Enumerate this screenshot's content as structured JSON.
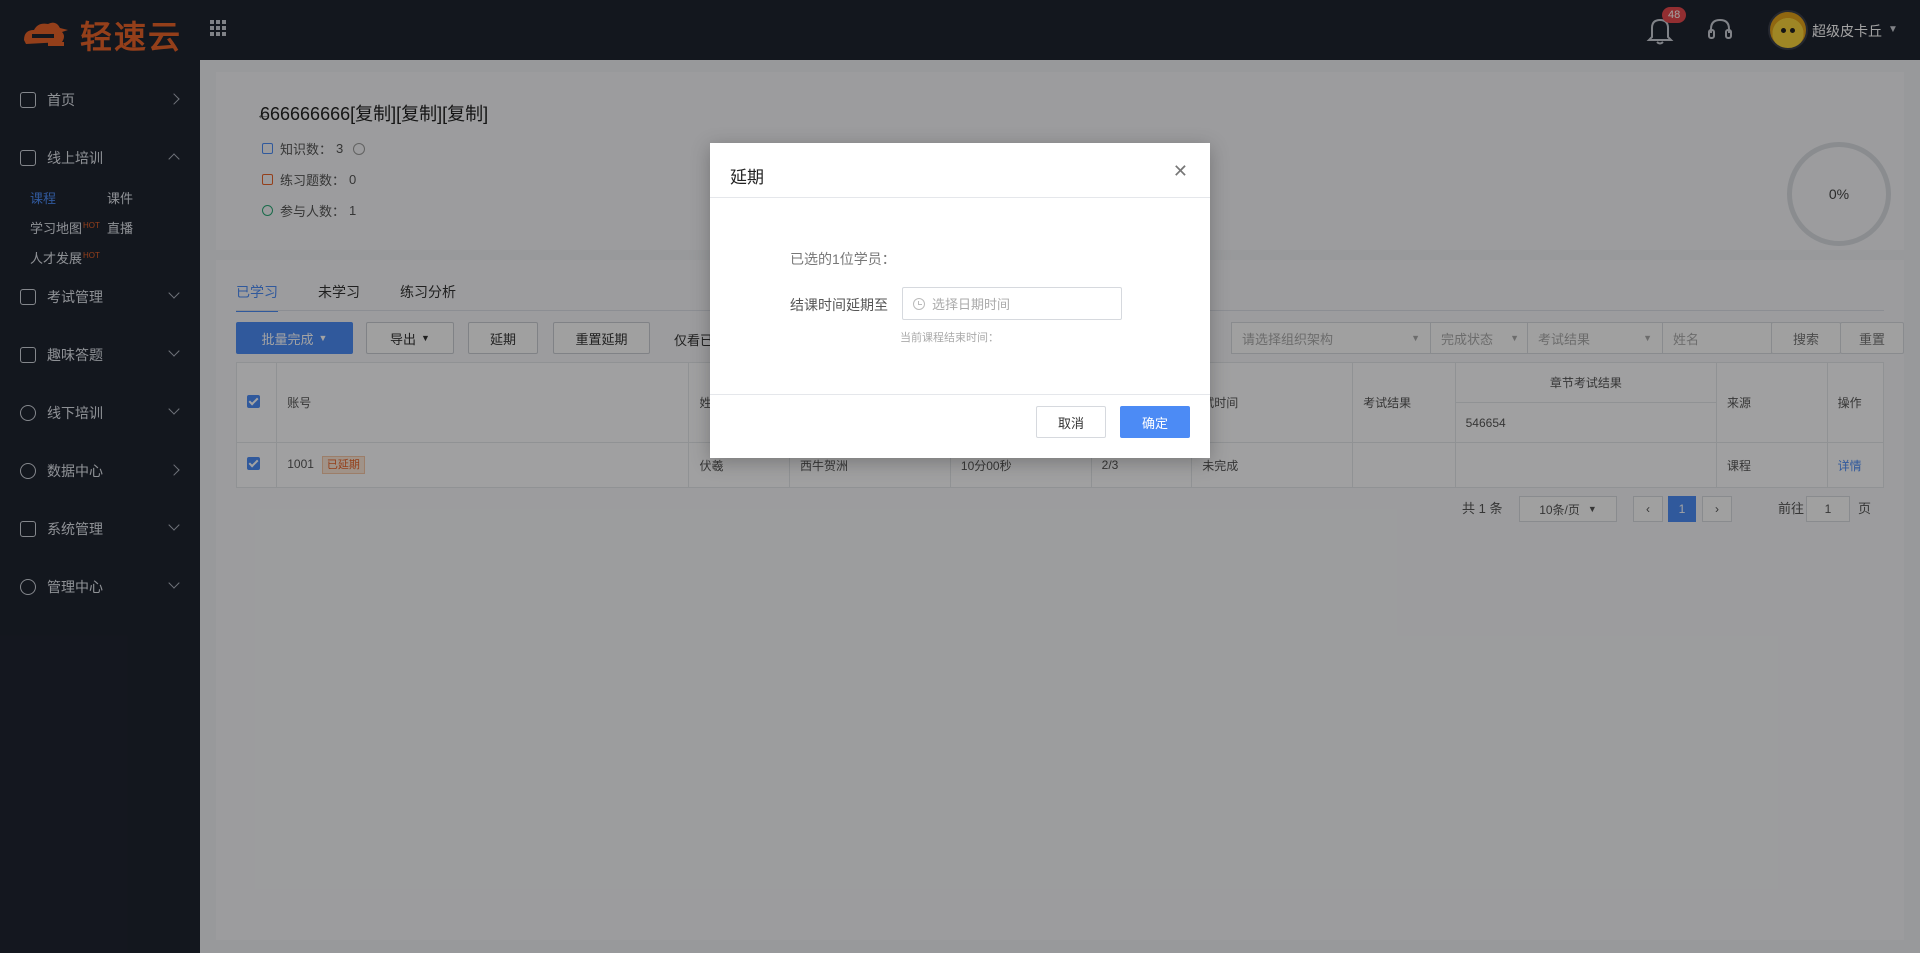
{
  "header": {
    "brand": "轻速云",
    "notification_count": "48",
    "user_name": "超级皮卡丘"
  },
  "sidebar": {
    "items": [
      {
        "label": "首页"
      },
      {
        "label": "线上培训"
      },
      {
        "label": "考试管理"
      },
      {
        "label": "趣味答题"
      },
      {
        "label": "线下培训"
      },
      {
        "label": "数据中心"
      },
      {
        "label": "系统管理"
      },
      {
        "label": "管理中心"
      }
    ],
    "sub": {
      "course": "课程",
      "courseware": "课件",
      "learning_map": "学习地图",
      "live": "直播",
      "talent": "人才发展",
      "hot": "HOT"
    }
  },
  "course": {
    "title": "666666666[复制][复制][复制]",
    "knowledge_label": "知识数：",
    "knowledge_value": "3",
    "practice_label": "练习题数：",
    "practice_value": "0",
    "participants_label": "参与人数：",
    "participants_value": "1",
    "progress": "0%"
  },
  "tabs": [
    "已学习",
    "未学习",
    "练习分析"
  ],
  "toolbar": {
    "batch_complete": "批量完成",
    "export": "导出",
    "extend": "延期",
    "reset_extend": "重置延期",
    "only_view": "仅看已",
    "org_placeholder": "请选择组织架构",
    "status_placeholder": "完成状态",
    "exam_placeholder": "考试结果",
    "name_placeholder": "姓名",
    "search": "搜索",
    "reset": "重置"
  },
  "table": {
    "headers": {
      "account": "账号",
      "name": "姓",
      "study_time": "试时间",
      "exam_result": "考试结果",
      "chapter_exam": "章节考试结果",
      "chapter_sub": "546654",
      "source": "来源",
      "action": "操作"
    },
    "row": {
      "account": "1001",
      "tag": "已延期",
      "name": "伏羲",
      "dept": "西牛贺洲",
      "duration": "10分00秒",
      "progress": "2/3",
      "status": "未完成",
      "source": "课程",
      "action": "详情"
    }
  },
  "pager": {
    "total": "共 1 条",
    "page_size": "10条/页",
    "current": "1",
    "goto_label": "前往",
    "goto_value": "1",
    "page_suffix": "页"
  },
  "modal": {
    "title": "延期",
    "selected_text": "已选的1位学员：",
    "field_label": "结课时间延期至",
    "placeholder": "选择日期时间",
    "hint": "当前课程结束时间：",
    "cancel": "取消",
    "confirm": "确定"
  }
}
